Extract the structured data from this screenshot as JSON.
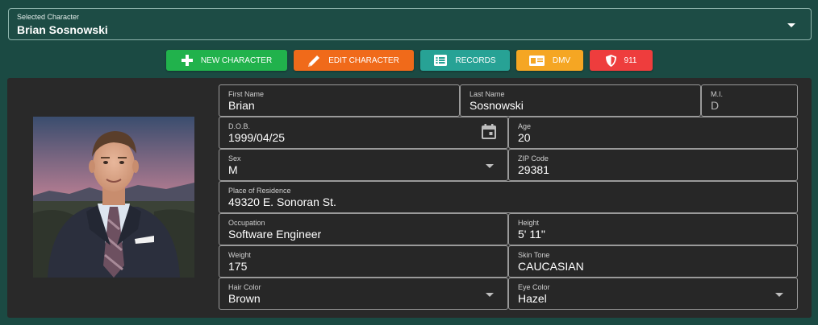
{
  "selected_character": {
    "label": "Selected Character",
    "value": "Brian Sosnowski"
  },
  "actions": {
    "new_character": "NEW CHARACTER",
    "edit_character": "EDIT CHARACTER",
    "records": "RECORDS",
    "dmv": "DMV",
    "emergency": "911"
  },
  "colors": {
    "background": "#1b4a43",
    "panel": "#292929",
    "new_character": "#21b24c",
    "edit_character": "#f06a1a",
    "records": "#27a295",
    "dmv": "#f5a623",
    "emergency": "#ee3d3d"
  },
  "icons": {
    "new_character": "plus-icon",
    "edit_character": "pencil-icon",
    "records": "list-icon",
    "dmv": "id-card-icon",
    "emergency": "shield-icon",
    "dob": "calendar-icon"
  },
  "form": {
    "first_name": {
      "label": "First Name",
      "value": "Brian"
    },
    "last_name": {
      "label": "Last Name",
      "value": "Sosnowski"
    },
    "mi": {
      "label": "M.I.",
      "value": "D"
    },
    "dob": {
      "label": "D.O.B.",
      "value": "1999/04/25"
    },
    "age": {
      "label": "Age",
      "value": "20"
    },
    "sex": {
      "label": "Sex",
      "value": "M"
    },
    "zip": {
      "label": "ZIP Code",
      "value": "29381"
    },
    "residence": {
      "label": "Place of Residence",
      "value": "49320 E. Sonoran St."
    },
    "occupation": {
      "label": "Occupation",
      "value": "Software Engineer"
    },
    "height": {
      "label": "Height",
      "value": "5' 11\""
    },
    "weight": {
      "label": "Weight",
      "value": "175"
    },
    "skin_tone": {
      "label": "Skin Tone",
      "value": "CAUCASIAN"
    },
    "hair_color": {
      "label": "Hair Color",
      "value": "Brown"
    },
    "eye_color": {
      "label": "Eye Color",
      "value": "Hazel"
    }
  }
}
